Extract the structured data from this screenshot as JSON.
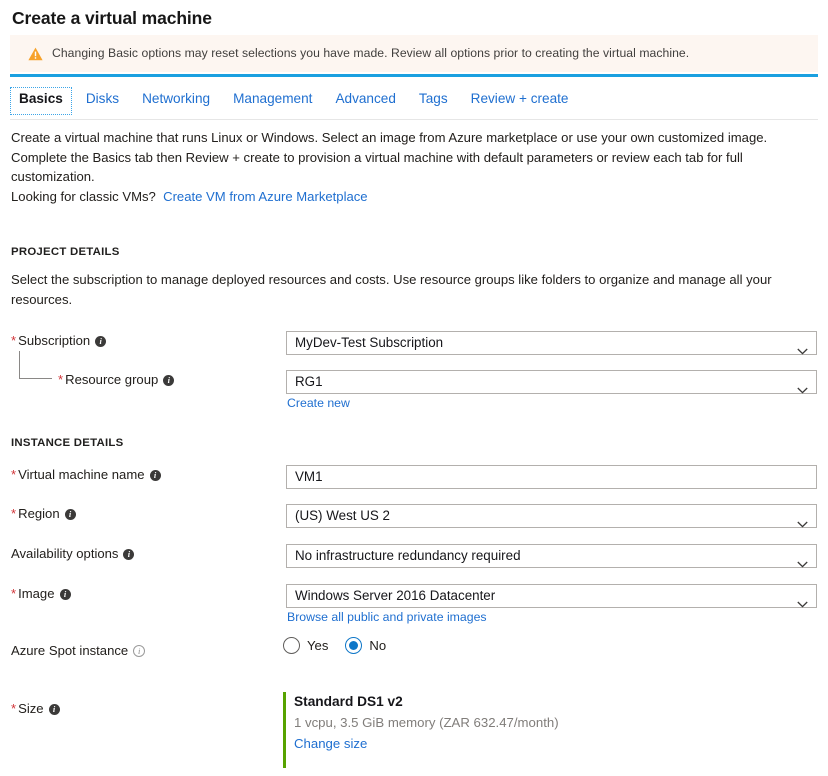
{
  "page": {
    "title": "Create a virtual machine"
  },
  "warning": {
    "icon": "warning-triangle-icon",
    "text": "Changing Basic options may reset selections you have made. Review all options prior to creating the virtual machine."
  },
  "tabs": [
    {
      "label": "Basics",
      "active": true
    },
    {
      "label": "Disks",
      "active": false
    },
    {
      "label": "Networking",
      "active": false
    },
    {
      "label": "Management",
      "active": false
    },
    {
      "label": "Advanced",
      "active": false
    },
    {
      "label": "Tags",
      "active": false
    },
    {
      "label": "Review + create",
      "active": false
    }
  ],
  "intro": {
    "line1": "Create a virtual machine that runs Linux or Windows. Select an image from Azure marketplace or use your own customized image.",
    "line2": "Complete the Basics tab then Review + create to provision a virtual machine with default parameters or review each tab for full customization.",
    "line3_prefix": "Looking for classic VMs?",
    "line3_link": "Create VM from Azure Marketplace"
  },
  "project_details": {
    "heading": "PROJECT DETAILS",
    "description": "Select the subscription to manage deployed resources and costs. Use resource groups like folders to organize and manage all your resources.",
    "subscription": {
      "label": "Subscription",
      "required": "*",
      "value": "MyDev-Test Subscription"
    },
    "resource_group": {
      "label": "Resource group",
      "required": "*",
      "value": "RG1",
      "create_new": "Create new"
    }
  },
  "instance_details": {
    "heading": "INSTANCE DETAILS",
    "vm_name": {
      "label": "Virtual machine name",
      "required": "*",
      "value": "VM1"
    },
    "region": {
      "label": "Region",
      "required": "*",
      "value": "(US) West US 2"
    },
    "availability": {
      "label": "Availability options",
      "value": "No infrastructure redundancy required"
    },
    "image": {
      "label": "Image",
      "required": "*",
      "value": "Windows Server 2016 Datacenter",
      "browse_link": "Browse all public and private images"
    },
    "spot_instance": {
      "label": "Azure Spot instance",
      "options": [
        {
          "label": "Yes",
          "selected": false
        },
        {
          "label": "No",
          "selected": true
        }
      ]
    },
    "size": {
      "label": "Size",
      "required": "*",
      "name": "Standard DS1 v2",
      "spec": "1 vcpu, 3.5 GiB memory (ZAR 632.47/month)",
      "change_link": "Change size"
    }
  },
  "colors": {
    "link": "#1f6fd0",
    "accent_blue": "#1aa0e0",
    "required_red": "#d13438",
    "warning_bg": "#fdf6f1",
    "warning_icon": "#f7a22b",
    "size_accent_green": "#57a300"
  }
}
